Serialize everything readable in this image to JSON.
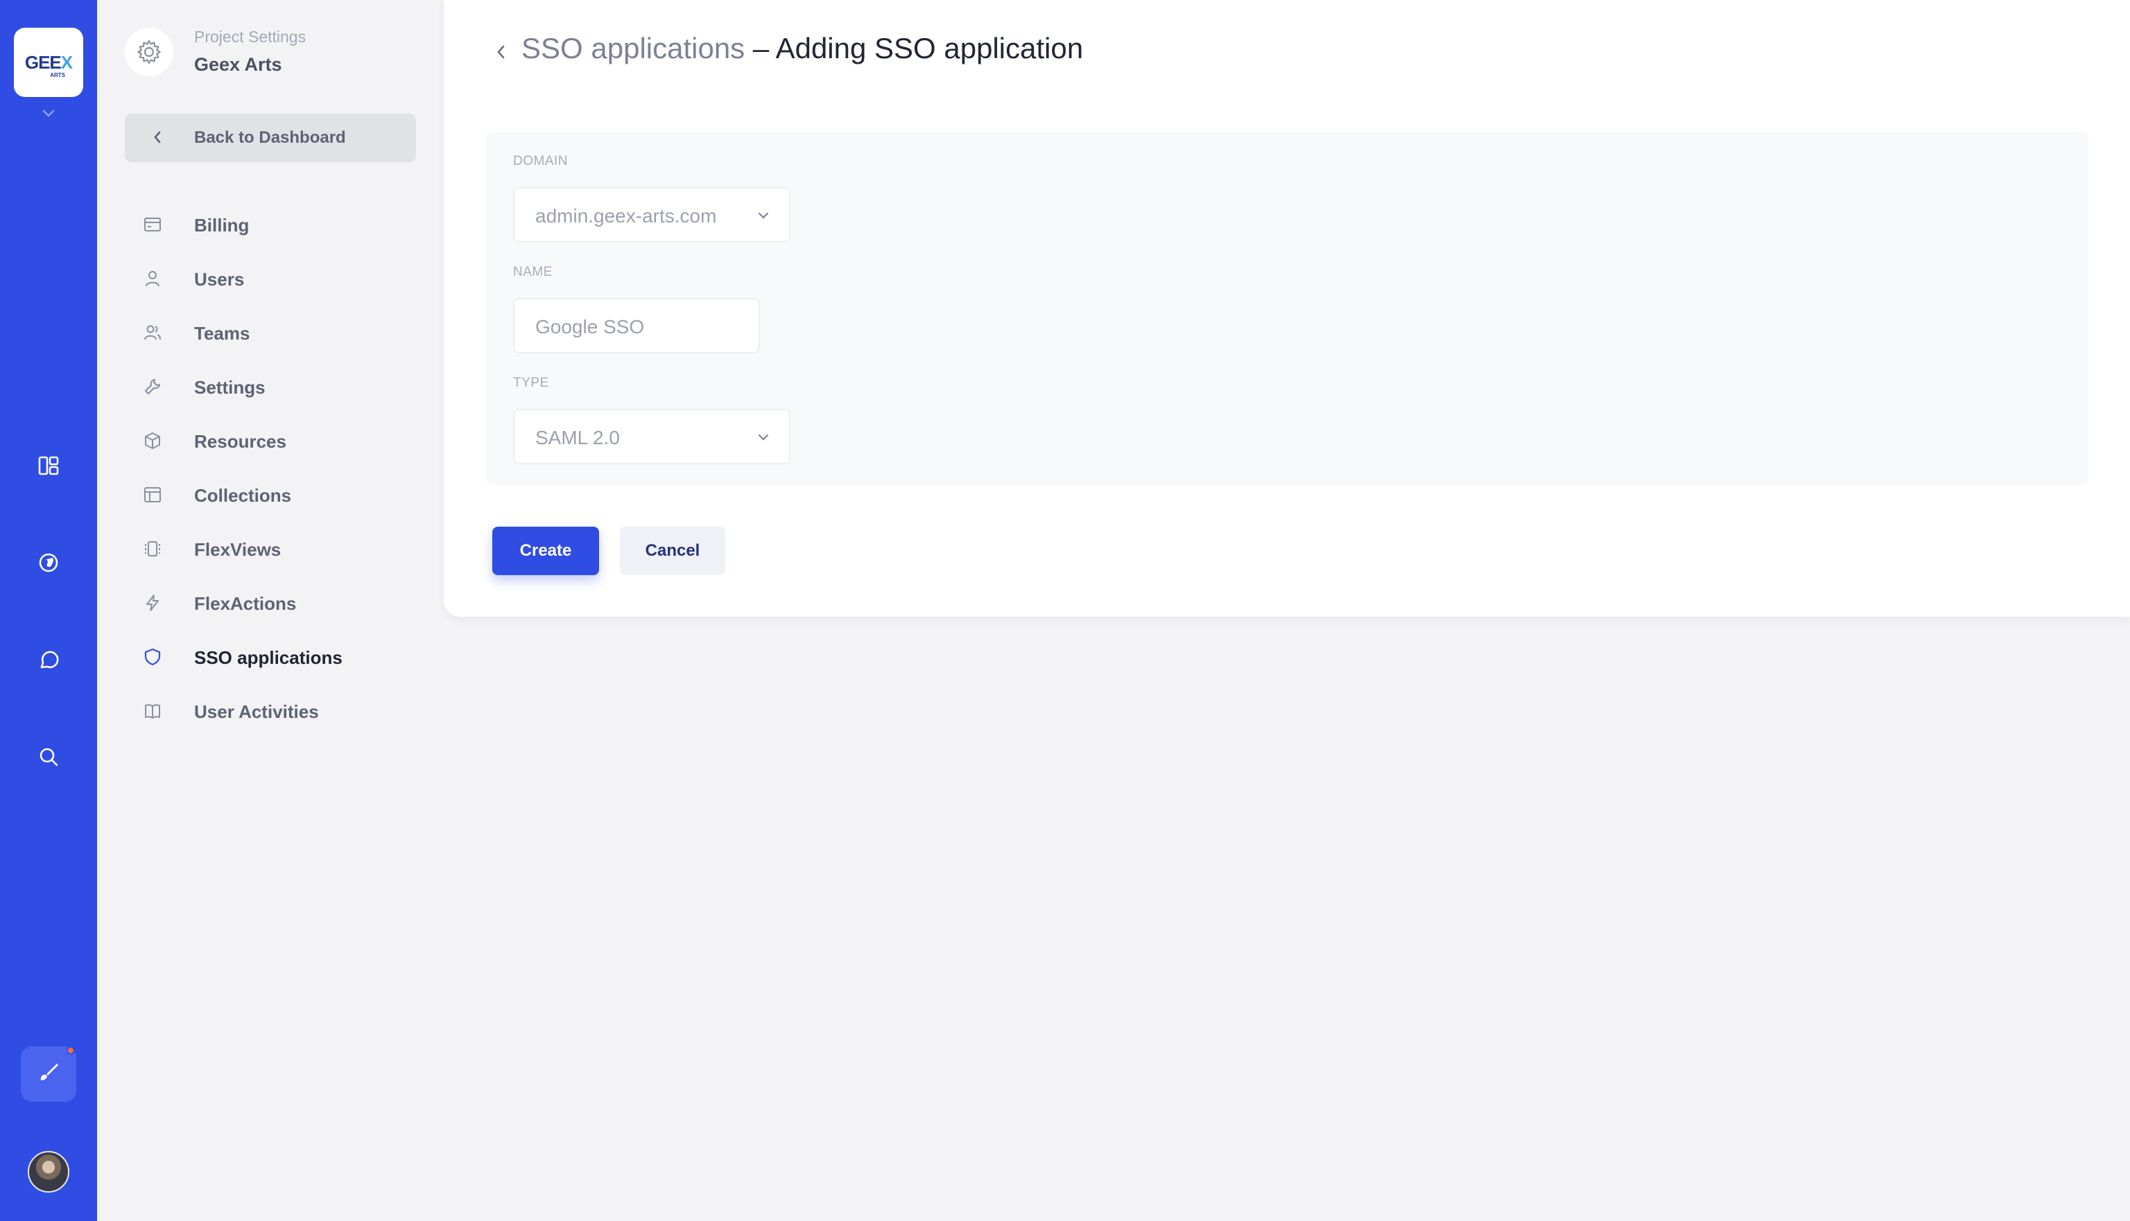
{
  "rail": {
    "logo_text_main": "GEE",
    "logo_text_x": "X",
    "logo_text_sub": "ARTS",
    "icons": [
      "dashboard-icon",
      "globe-icon",
      "chat-icon",
      "search-icon",
      "brush-icon"
    ]
  },
  "project": {
    "subtitle": "Project Settings",
    "name": "Geex Arts"
  },
  "sidebar": {
    "back_label": "Back to Dashboard",
    "items": [
      {
        "label": "Billing",
        "icon": "billing-icon"
      },
      {
        "label": "Users",
        "icon": "user-icon"
      },
      {
        "label": "Teams",
        "icon": "teams-icon"
      },
      {
        "label": "Settings",
        "icon": "wrench-icon"
      },
      {
        "label": "Resources",
        "icon": "cube-icon"
      },
      {
        "label": "Collections",
        "icon": "table-icon"
      },
      {
        "label": "FlexViews",
        "icon": "flexviews-icon"
      },
      {
        "label": "FlexActions",
        "icon": "bolt-icon"
      },
      {
        "label": "SSO applications",
        "icon": "shield-icon",
        "active": true
      },
      {
        "label": "User Activities",
        "icon": "book-icon"
      }
    ]
  },
  "page": {
    "breadcrumb": "SSO applications",
    "title_suffix": " – Adding SSO application"
  },
  "form": {
    "domain_label": "DOMAIN",
    "domain_value": "admin.geex-arts.com",
    "name_label": "NAME",
    "name_placeholder": "Google SSO",
    "type_label": "TYPE",
    "type_value": "SAML 2.0"
  },
  "buttons": {
    "create": "Create",
    "cancel": "Cancel"
  },
  "colors": {
    "brand": "#2f4de3",
    "active_icon": "#2f4de3"
  }
}
